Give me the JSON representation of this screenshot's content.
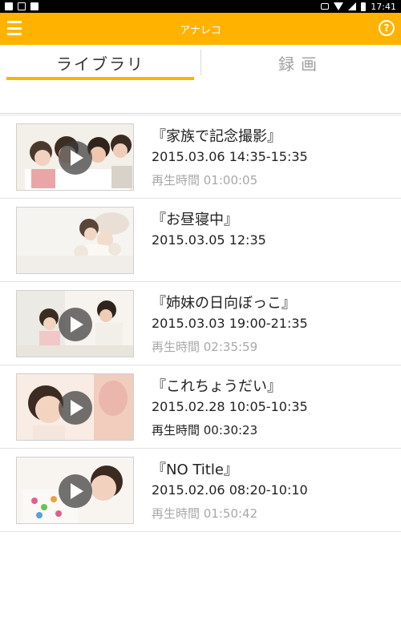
{
  "status_bar": {
    "time": "17:41",
    "icons_left": [
      "image-notification-icon",
      "sim-card-icon",
      "shopping-bag-icon"
    ],
    "icons_right": [
      "vibrate-icon",
      "wifi-icon",
      "signal-icon",
      "battery-icon"
    ]
  },
  "app_bar": {
    "title": "アナレコ",
    "help_symbol": "?",
    "accent_color": "#ffb300"
  },
  "tabs": [
    {
      "label": "ライブラリ",
      "active": true
    },
    {
      "label": "録画",
      "active": false
    }
  ],
  "items": [
    {
      "title": "『家族で記念撮影』",
      "date": "2015.03.06 14:35-15:35",
      "duration": "再生時間 01:00:05",
      "duration_dark": false,
      "has_play": true
    },
    {
      "title": "『お昼寝中』",
      "date": "2015.03.05 12:35",
      "duration": "",
      "duration_dark": false,
      "has_play": false
    },
    {
      "title": "『姉妹の日向ぼっこ』",
      "date": "2015.03.03 19:00-21:35",
      "duration": "再生時間 02:35:59",
      "duration_dark": false,
      "has_play": true
    },
    {
      "title": "『これちょうだい』",
      "date": "2015.02.28 10:05-10:35",
      "duration": "再生時間 00:30:23",
      "duration_dark": true,
      "has_play": true
    },
    {
      "title": "『NO Title』",
      "date": "2015.02.06 08:20-10:10",
      "duration": "再生時間 01:50:42",
      "duration_dark": false,
      "has_play": true
    }
  ]
}
